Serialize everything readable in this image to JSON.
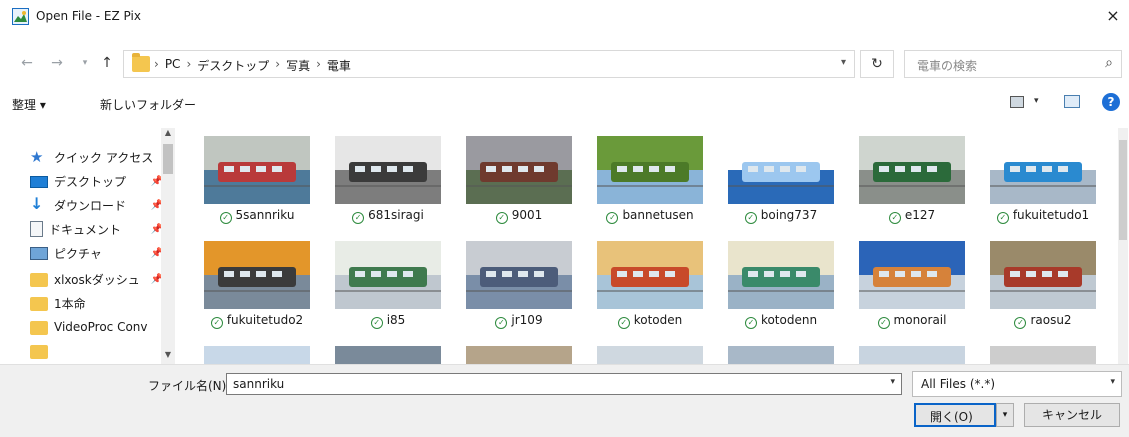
{
  "window": {
    "title": "Open File - EZ Pix",
    "close": "×"
  },
  "address": {
    "crumbs": [
      "PC",
      "デスクトップ",
      "写真",
      "電車"
    ],
    "separator": "›",
    "search_placeholder": "電車の検索"
  },
  "toolbar": {
    "organize_label": "整理 ▾",
    "new_folder_label": "新しいフォルダー",
    "help_label": "?"
  },
  "sidebar": {
    "items": [
      {
        "label": "クイック アクセス",
        "icon": "star-icon"
      },
      {
        "label": "デスクトップ",
        "icon": "desktop-icon"
      },
      {
        "label": "ダウンロード",
        "icon": "download-icon"
      },
      {
        "label": "ドキュメント",
        "icon": "documents-icon"
      },
      {
        "label": "ピクチャ",
        "icon": "pictures-icon"
      },
      {
        "label": "xlxoskダッシュ",
        "icon": "folder-icon"
      },
      {
        "label": "1本命",
        "icon": "folder-icon"
      },
      {
        "label": "VideoProc Conv",
        "icon": "folder-icon"
      }
    ]
  },
  "files": [
    {
      "name": "5sannriku",
      "colors": [
        "#4e7a9a",
        "#c0c6c0",
        "#b93a3a"
      ]
    },
    {
      "name": "681siragi",
      "colors": [
        "#7d7d7d",
        "#e6e6e6",
        "#3b3b3b"
      ]
    },
    {
      "name": "9001",
      "colors": [
        "#5b6e52",
        "#9a9aa0",
        "#6f3a2e"
      ]
    },
    {
      "name": "bannetusen",
      "colors": [
        "#8ab4d8",
        "#6a9a3a",
        "#4c7a28"
      ]
    },
    {
      "name": "boing737",
      "colors": [
        "#2a6ab8",
        "#ffffff",
        "#9cc7ef"
      ]
    },
    {
      "name": "e127",
      "colors": [
        "#8a8f8a",
        "#cfd5cf",
        "#2b6a3a"
      ]
    },
    {
      "name": "fukuitetudo1",
      "colors": [
        "#a8b8c8",
        "#ffffff",
        "#2a8ad0"
      ]
    },
    {
      "name": "fukuitetudo2",
      "colors": [
        "#7a8a9a",
        "#e3962a",
        "#3b3b3b"
      ]
    },
    {
      "name": "i85",
      "colors": [
        "#bfc7cf",
        "#e8ece6",
        "#3f7a4e"
      ]
    },
    {
      "name": "jr109",
      "colors": [
        "#7a8ea8",
        "#c8ccd2",
        "#4c5c7a"
      ]
    },
    {
      "name": "kotoden",
      "colors": [
        "#a8c4d8",
        "#e8c27a",
        "#c84a2a"
      ]
    },
    {
      "name": "kotodenn",
      "colors": [
        "#9ab2c6",
        "#e9e4cc",
        "#3a8a6a"
      ]
    },
    {
      "name": "monorail",
      "colors": [
        "#c7d2dd",
        "#2b64b8",
        "#d6823a"
      ]
    },
    {
      "name": "raosu2",
      "colors": [
        "#bfc9d2",
        "#9a8a6a",
        "#a83a2a"
      ]
    },
    {
      "name": "",
      "colors": [
        "#7aa6d0",
        "#c8d8e8",
        "#e8eef4"
      ]
    },
    {
      "name": "",
      "colors": [
        "#3a4a5a",
        "#7a8a9a",
        "#c8d0d8"
      ]
    },
    {
      "name": "",
      "colors": [
        "#6a6a6a",
        "#b5a48a",
        "#d8d8d8"
      ]
    },
    {
      "name": "",
      "colors": [
        "#5a8ac0",
        "#cfd8e0",
        "#f0f0f0"
      ]
    },
    {
      "name": "",
      "colors": [
        "#3a5a7a",
        "#a8b8c8",
        "#d8a04a"
      ]
    },
    {
      "name": "",
      "colors": [
        "#6a8ab0",
        "#c8d4e0",
        "#e8e8e8"
      ]
    },
    {
      "name": "",
      "colors": [
        "#8a8a8a",
        "#cdcdcd",
        "#6a5a4a"
      ]
    }
  ],
  "footer": {
    "filename_label": "ファイル名(N):",
    "filename_value": "sannriku",
    "filter_value": "All Files (*.*)",
    "open_label": "開く(O)",
    "cancel_label": "キャンセル"
  }
}
